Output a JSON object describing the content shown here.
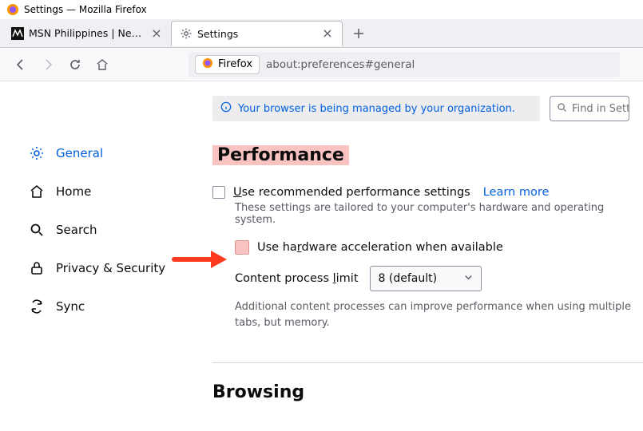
{
  "titlebar": {
    "text": "Settings — Mozilla Firefox"
  },
  "tabs": {
    "inactive": {
      "label": "MSN Philippines | News, Outloo"
    },
    "active": {
      "label": "Settings"
    }
  },
  "urlbar": {
    "identity": "Firefox",
    "url": "about:preferences#general"
  },
  "sidebar": {
    "general": "General",
    "home": "Home",
    "search": "Search",
    "privacy": "Privacy & Security",
    "sync": "Sync"
  },
  "infobar": {
    "text": "Your browser is being managed by your organization."
  },
  "searchbox": {
    "placeholder": "Find in Settings"
  },
  "perf": {
    "heading": "Performance",
    "useRecPrefix": "U",
    "useRecRest": "se recommended performance settings",
    "learnMore": "Learn more",
    "tailored": "These settings are tailored to your computer's hardware and operating system.",
    "hwAccelBefore": "Use ha",
    "hwAccelUL": "r",
    "hwAccelAfter": "dware acceleration when available",
    "cplBefore": "Content process ",
    "cplUL": "l",
    "cplAfter": "imit",
    "dropdownValue": "8 (default)",
    "additional": "Additional content processes can improve performance when using multiple tabs, but memory."
  },
  "browsing": {
    "heading": "Browsing"
  }
}
